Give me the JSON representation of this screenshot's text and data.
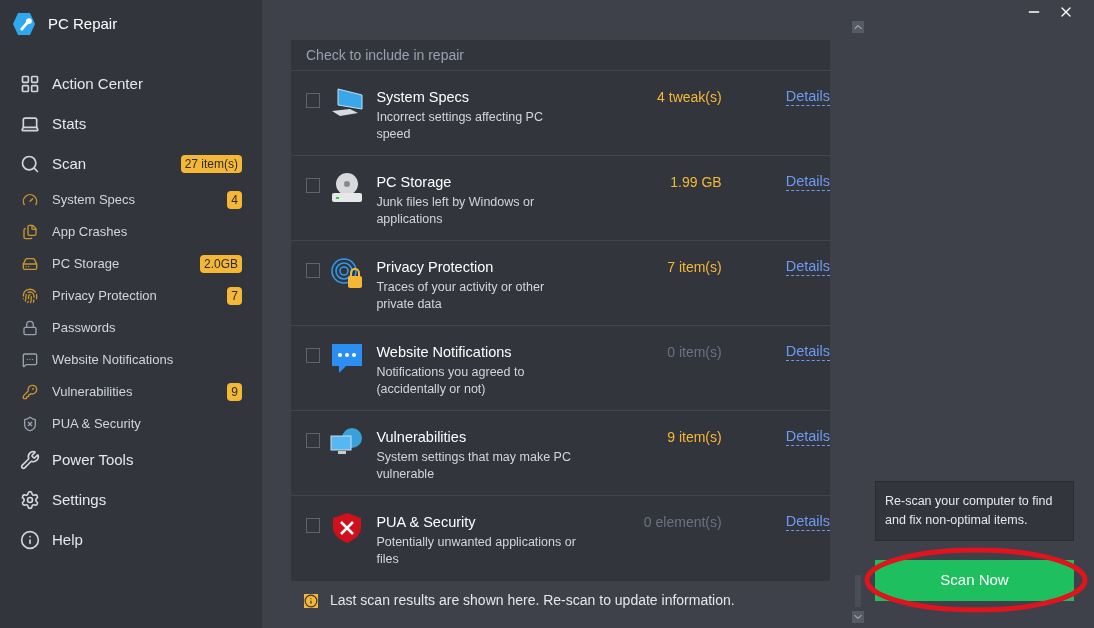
{
  "app": {
    "title": "PC Repair"
  },
  "sidebar": {
    "items": [
      {
        "kind": "main",
        "label": "Action Center"
      },
      {
        "kind": "main",
        "label": "Stats"
      },
      {
        "kind": "main",
        "label": "Scan",
        "badge": "27 item(s)"
      },
      {
        "kind": "sub",
        "label": "System Specs",
        "badge": "4"
      },
      {
        "kind": "sub",
        "label": "App Crashes"
      },
      {
        "kind": "sub",
        "label": "PC Storage",
        "badge": "2.0GB"
      },
      {
        "kind": "sub",
        "label": "Privacy Protection",
        "badge": "7"
      },
      {
        "kind": "sub",
        "label": "Passwords"
      },
      {
        "kind": "sub",
        "label": "Website Notifications"
      },
      {
        "kind": "sub",
        "label": "Vulnerabilities",
        "badge": "9"
      },
      {
        "kind": "sub",
        "label": "PUA & Security"
      },
      {
        "kind": "main",
        "label": "Power Tools"
      },
      {
        "kind": "main",
        "label": "Settings"
      },
      {
        "kind": "main",
        "label": "Help"
      }
    ]
  },
  "panel": {
    "header": "Check to include in repair",
    "rows": [
      {
        "title": "System Specs",
        "description": "Incorrect settings affecting PC speed",
        "count": "4 tweak(s)",
        "highlight": true,
        "checked": false,
        "link": "Details"
      },
      {
        "title": "PC Storage",
        "description": "Junk files left by Windows or applications",
        "count": "1.99 GB",
        "highlight": true,
        "checked": false,
        "link": "Details"
      },
      {
        "title": "Privacy Protection",
        "description": "Traces of your activity or other private data",
        "count": "7 item(s)",
        "highlight": true,
        "checked": false,
        "link": "Details"
      },
      {
        "title": "Website Notifications",
        "description": "Notifications you agreed to (accidentally or not)",
        "count": "0 item(s)",
        "highlight": false,
        "checked": false,
        "link": "Details"
      },
      {
        "title": "Vulnerabilities",
        "description": "System settings that may make PC vulnerable",
        "count": "9 item(s)",
        "highlight": true,
        "checked": false,
        "link": "Details"
      },
      {
        "title": "PUA & Security",
        "description": "Potentially unwanted applications or files",
        "count": "0 element(s)",
        "highlight": false,
        "checked": false,
        "link": "Details"
      }
    ],
    "note": "Last scan results are shown here. Re-scan to update information."
  },
  "aside": {
    "hint": "Re-scan your computer to find and fix non-optimal items.",
    "button": "Scan Now"
  }
}
